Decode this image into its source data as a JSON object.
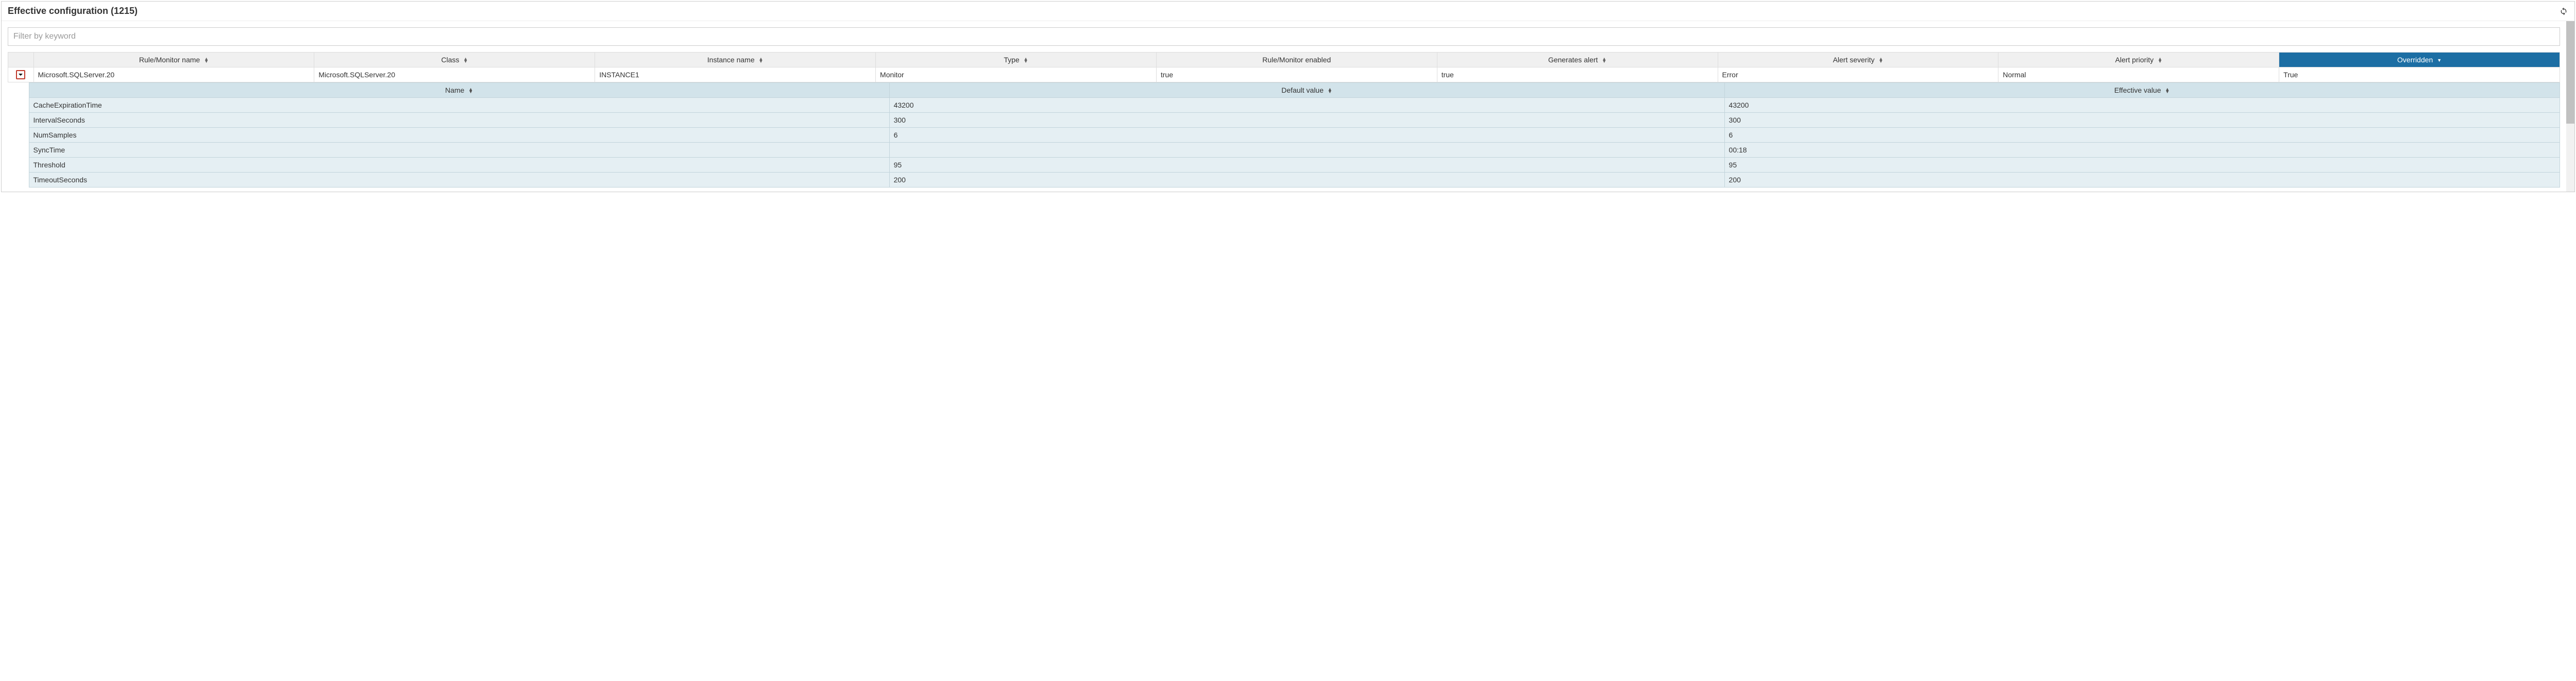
{
  "panel": {
    "title": "Effective configuration (1215)"
  },
  "filter": {
    "placeholder": "Filter by keyword",
    "value": ""
  },
  "columns": {
    "rule_monitor_name": "Rule/Monitor name",
    "class": "Class",
    "instance_name": "Instance name",
    "type": "Type",
    "rule_monitor_enabled": "Rule/Monitor enabled",
    "generates_alert": "Generates alert",
    "alert_severity": "Alert severity",
    "alert_priority": "Alert priority",
    "overridden": "Overridden"
  },
  "row": {
    "rule_monitor_name": "Microsoft.SQLServer.20",
    "class": "Microsoft.SQLServer.20",
    "instance_name": "INSTANCE1",
    "type": "Monitor",
    "rule_monitor_enabled": "true",
    "generates_alert": "true",
    "alert_severity": "Error",
    "alert_priority": "Normal",
    "overridden": "True"
  },
  "detail_columns": {
    "name": "Name",
    "default_value": "Default value",
    "effective_value": "Effective value"
  },
  "details": [
    {
      "name": "CacheExpirationTime",
      "default_value": "43200",
      "effective_value": "43200"
    },
    {
      "name": "IntervalSeconds",
      "default_value": "300",
      "effective_value": "300"
    },
    {
      "name": "NumSamples",
      "default_value": "6",
      "effective_value": "6"
    },
    {
      "name": "SyncTime",
      "default_value": "",
      "effective_value": "00:18"
    },
    {
      "name": "Threshold",
      "default_value": "95",
      "effective_value": "95"
    },
    {
      "name": "TimeoutSeconds",
      "default_value": "200",
      "effective_value": "200"
    }
  ]
}
